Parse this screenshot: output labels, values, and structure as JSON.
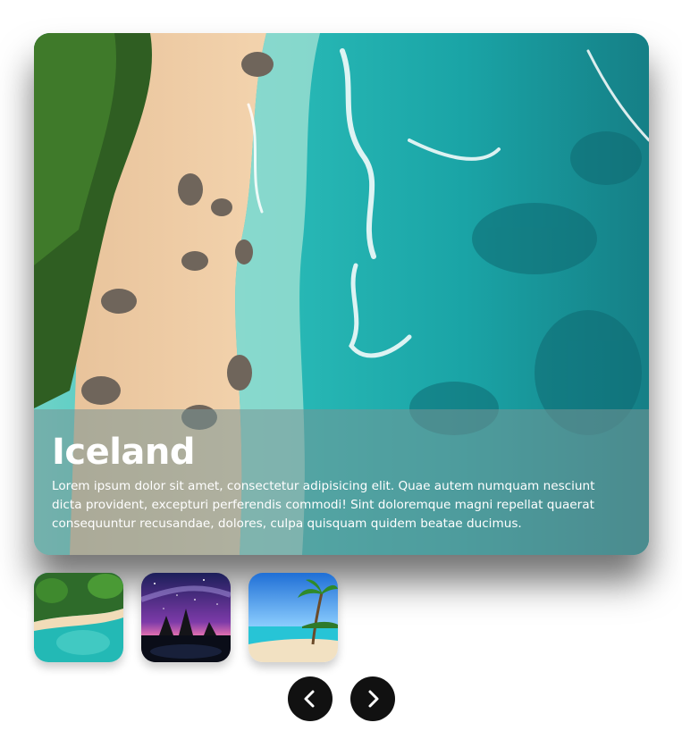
{
  "slide": {
    "title": "Iceland",
    "description": "Lorem ipsum dolor sit amet, consectetur adipisicing elit. Quae autem numquam nesciunt dicta provident, excepturi perferendis commodi! Sint doloremque magni repellat quaerat consequuntur recusandae, dolores, culpa quisquam quidem beatae ducimus.",
    "image": "aerial-beach-photo"
  },
  "thumbnails": [
    {
      "image": "tropical-island-photo"
    },
    {
      "image": "night-sky-rocks-photo"
    },
    {
      "image": "palm-beach-photo"
    }
  ],
  "nav": {
    "prev_icon": "chevron-left-icon",
    "next_icon": "chevron-right-icon"
  },
  "colors": {
    "button_bg": "#111111",
    "caption_overlay": "rgba(120,150,150,0.55)",
    "caption_text": "#ffffff"
  }
}
